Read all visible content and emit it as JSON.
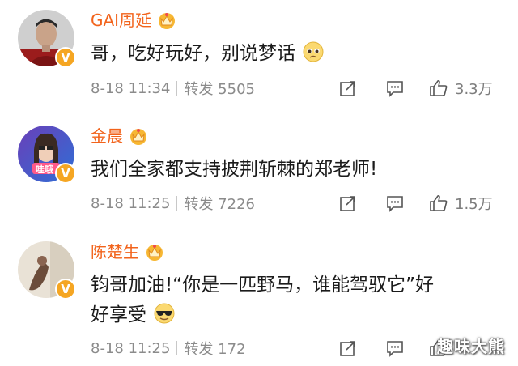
{
  "comments": [
    {
      "author": "GAI周延",
      "text": "哥，吃好玩好，别说梦话",
      "emoji": "pleading-face-icon",
      "time": "8-18 11:34",
      "repost": "转发 5505",
      "likes": "3.3万",
      "avatar_label": ""
    },
    {
      "author": "金晨",
      "text": "我们全家都支持披荆斩棘的郑老师!",
      "emoji": "",
      "time": "8-18 11:25",
      "repost": "转发 7226",
      "likes": "1.5万",
      "avatar_label": "哇哦"
    },
    {
      "author": "陈楚生",
      "text": "钧哥加油!“你是一匹野马，谁能驾驭它”好好享受",
      "text_line1": "钧哥加油!“你是一匹野马，谁能驾驭它”好",
      "text_line2": "好享受",
      "emoji": "sunglasses-face-icon",
      "time": "8-18 11:25",
      "repost": "转发 172",
      "likes": "",
      "avatar_label": ""
    }
  ],
  "verified_mark": "V",
  "watermark": "趣味大熊",
  "colors": {
    "author_name": "#f2631b",
    "verified_badge": "#f5a623",
    "meta_text": "#8b8b8b"
  }
}
